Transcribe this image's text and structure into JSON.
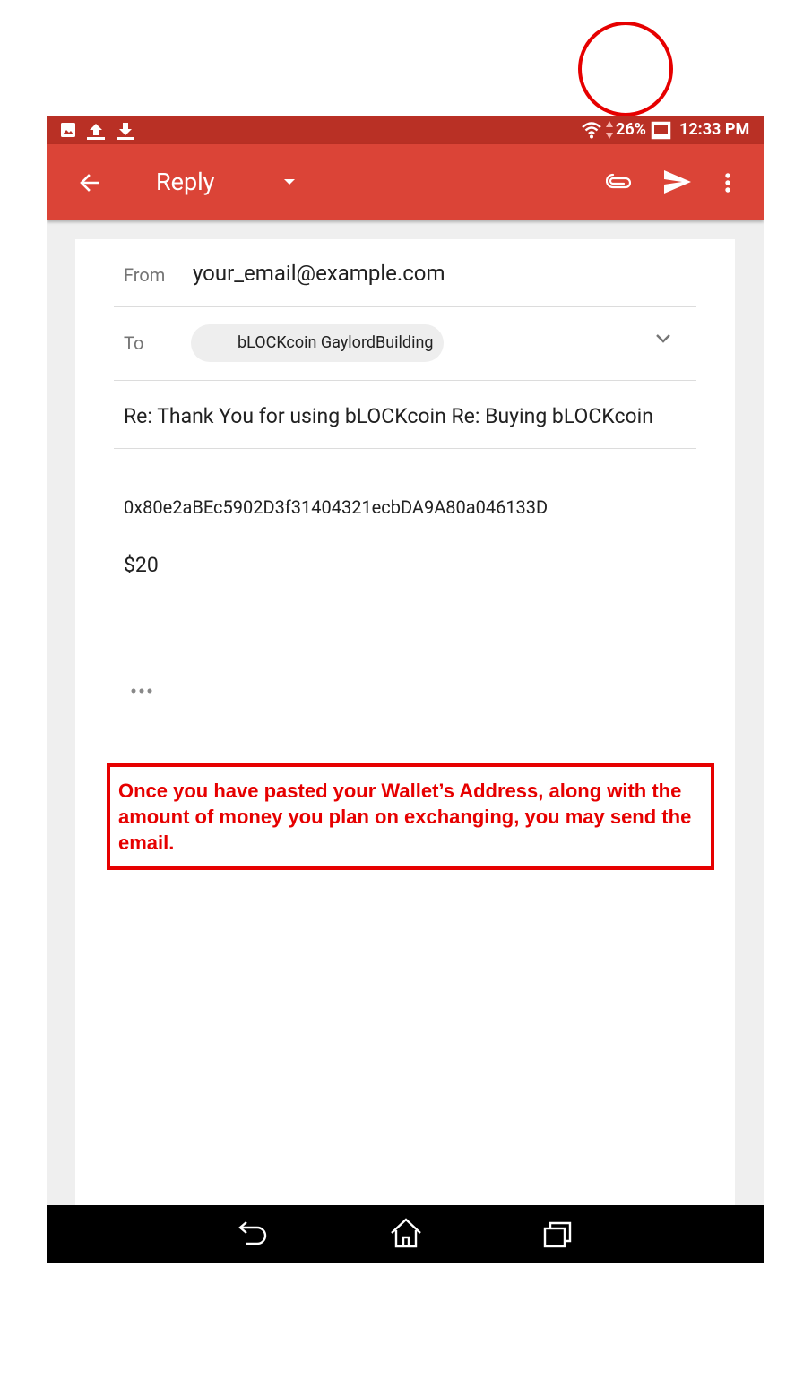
{
  "status_bar": {
    "battery": "26%",
    "time": "12:33 PM",
    "icons": [
      "image-icon",
      "upload-icon",
      "download-icon",
      "wifi-icon",
      "battery-icon"
    ]
  },
  "app_bar": {
    "title": "Reply",
    "icons": [
      "back-arrow-icon",
      "dropdown-arrow-icon",
      "attach-icon",
      "send-icon",
      "more-vert-icon"
    ]
  },
  "compose": {
    "from_label": "From",
    "from_value": "your_email@example.com",
    "to_label": "To",
    "to_chip": "bLOCKcoin GaylordBuilding",
    "subject": "Re: Thank You for using bLOCKcoin Re: Buying bLOCKcoin",
    "body_address": "0x80e2aBEc5902D3f31404321ecbDA9A80a046133D",
    "body_amount": "$20"
  },
  "annotation": {
    "text": "Once you have pasted your Wallet’s Address, along with the amount of money you plan on exchanging, you may send the email."
  },
  "colors": {
    "status_bar": "#b93025",
    "app_bar": "#db4437",
    "annotation_red": "#e60000",
    "nav_bar": "#000000"
  },
  "nav_bar": {
    "icons": [
      "back-icon",
      "home-icon",
      "recents-icon"
    ]
  }
}
